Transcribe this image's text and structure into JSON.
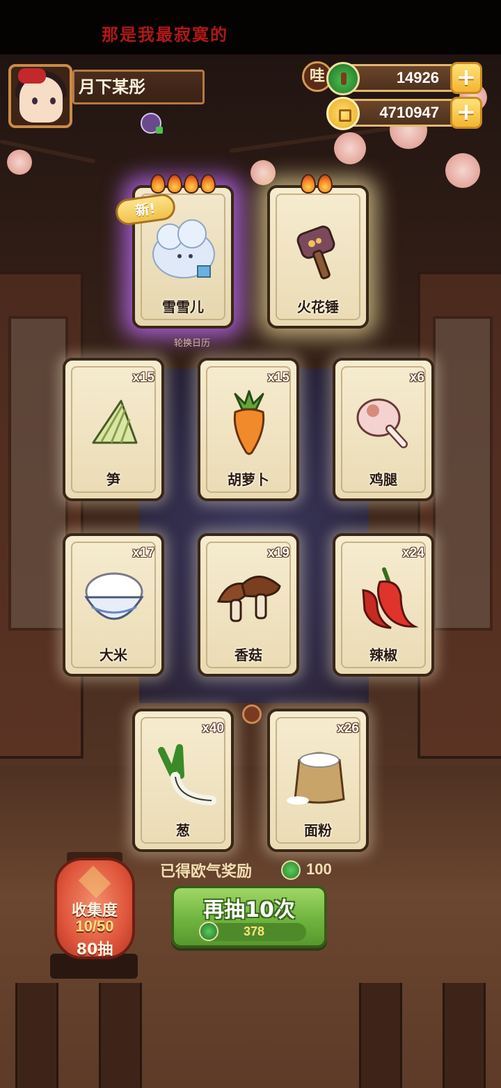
{
  "top_banner": {
    "text": "那是我最寂寞的"
  },
  "player": {
    "name": "月下某彤"
  },
  "currencies": {
    "wa_label": "哇",
    "jade": {
      "icon": "jade-icon",
      "value": "14926",
      "add_label": "+"
    },
    "coins": {
      "icon": "coin-icon",
      "value": "4710947",
      "add_label": "+"
    }
  },
  "featured": [
    {
      "name": "雪雪儿",
      "badge": "新!",
      "flames": 4,
      "rarity": "purple",
      "icon": "cloud-creature-icon"
    },
    {
      "name": "火花锤",
      "flames": 2,
      "rarity": "gold",
      "icon": "hammer-icon"
    }
  ],
  "calendar_label": "轮换日历",
  "cards": [
    {
      "name": "笋",
      "count": "x15",
      "icon": "bamboo-shoot-icon"
    },
    {
      "name": "胡萝卜",
      "count": "x15",
      "icon": "carrot-icon"
    },
    {
      "name": "鸡腿",
      "count": "x6",
      "icon": "drumstick-icon"
    },
    {
      "name": "大米",
      "count": "x17",
      "icon": "rice-bowl-icon"
    },
    {
      "name": "香菇",
      "count": "x19",
      "icon": "mushroom-icon"
    },
    {
      "name": "辣椒",
      "count": "x24",
      "icon": "chili-icon"
    },
    {
      "name": "葱",
      "count": "x40",
      "icon": "scallion-icon"
    },
    {
      "name": "面粉",
      "count": "x26",
      "icon": "flour-sack-icon"
    }
  ],
  "reward": {
    "label": "已得欧气奖励",
    "value": "100"
  },
  "redraw": {
    "label": "再抽10次",
    "cost": "378"
  },
  "collection": {
    "title": "收集度",
    "progress": "10/50",
    "pulls": "80抽"
  },
  "colors": {
    "accent_gold": "#f3b530",
    "button_green": "#6fb43f",
    "glow_purple": "#bf6eff"
  }
}
